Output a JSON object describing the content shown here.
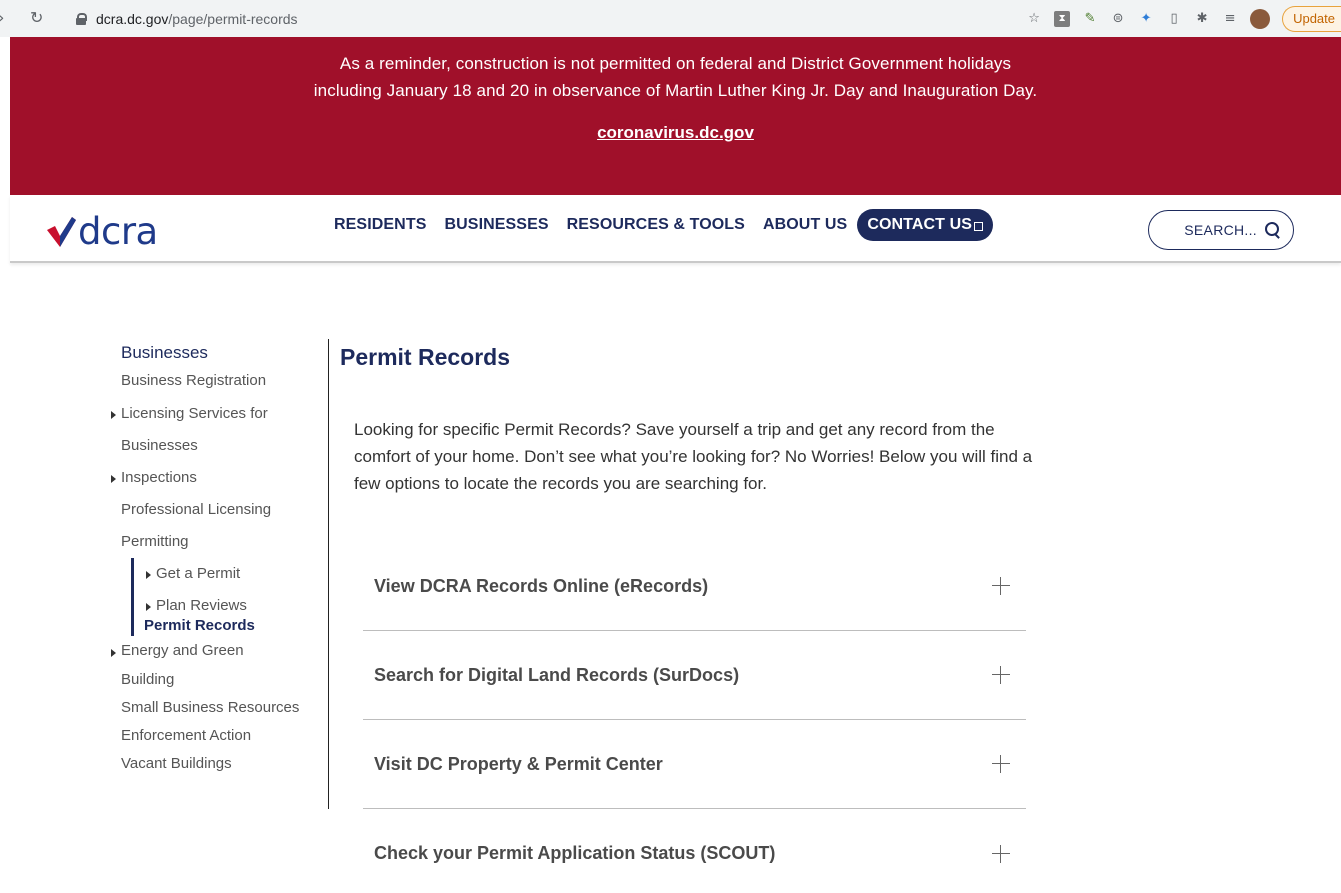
{
  "browser": {
    "url_host": "dcra.dc.gov",
    "url_path": "/page/permit-records",
    "update_label": "Update"
  },
  "alert": {
    "line1": "As a reminder, construction is not permitted on federal and District Government holidays",
    "line2": "including January 18 and 20 in observance of Martin Luther King Jr. Day and Inauguration Day.",
    "link": "coronavirus.dc.gov",
    "color": "#a0102a"
  },
  "header": {
    "logo_text": "dcra",
    "nav": {
      "residents": "RESIDENTS",
      "businesses": "BUSINESSES",
      "resources": "RESOURCES & TOOLS",
      "about": "ABOUT US",
      "contact": "CONTACT US"
    },
    "search_placeholder": "SEARCH...",
    "brand_color": "#1d2a5c"
  },
  "sidebar": {
    "heading": "Businesses",
    "items": [
      {
        "label": "Business Registration"
      },
      {
        "label": "Licensing Services for Businesses"
      },
      {
        "label": "Inspections"
      },
      {
        "label": "Professional Licensing"
      },
      {
        "label": "Permitting"
      },
      {
        "label": "Get a Permit"
      },
      {
        "label": "Plan Reviews"
      },
      {
        "label": "Permit Records"
      },
      {
        "label": "Energy and Green Building"
      },
      {
        "label": "Small Business Resources"
      },
      {
        "label": "Enforcement Action"
      },
      {
        "label": "Vacant Buildings"
      }
    ]
  },
  "main": {
    "title": "Permit Records",
    "intro": "Looking for specific Permit Records?  Save yourself a trip and get any record from the comfort of your home.  Don’t see what you’re looking for? No Worries! Below you will find a few options to locate the records you are searching for.",
    "accordion": [
      {
        "title": "View DCRA Records Online (eRecords)"
      },
      {
        "title": "Search for Digital Land Records (SurDocs)"
      },
      {
        "title": "Visit DC Property & Permit Center"
      },
      {
        "title": "Check your Permit Application Status (SCOUT)"
      }
    ]
  }
}
